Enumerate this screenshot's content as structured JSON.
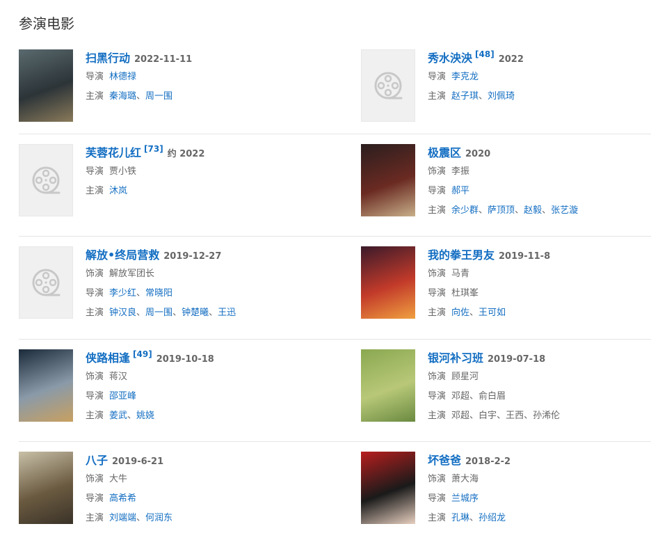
{
  "section": {
    "title": "参演电影"
  },
  "colors": {
    "link": "#136ec2",
    "muted": "#666666",
    "divider": "#e5e5e5"
  },
  "movies": [
    {
      "title": "扫黑行动",
      "ref": "",
      "year": "2022-11-11",
      "poster": {
        "kind": "image",
        "tones": [
          "#5a6a6e",
          "#2c3438",
          "#8a7a5a"
        ]
      },
      "credits": [
        {
          "label": "导演",
          "names": [
            "林德禄"
          ],
          "linked": true
        },
        {
          "label": "主演",
          "names": [
            "秦海璐",
            "周一围"
          ],
          "linked": true
        }
      ]
    },
    {
      "title": "秀水泱泱",
      "ref": "[48]",
      "year": "2022",
      "poster": {
        "kind": "placeholder"
      },
      "credits": [
        {
          "label": "导演",
          "names": [
            "李克龙"
          ],
          "linked": true
        },
        {
          "label": "主演",
          "names": [
            "赵子琪",
            "刘佩琦"
          ],
          "linked": true
        }
      ]
    },
    {
      "title": "芙蓉花儿红",
      "ref": "[73]",
      "year": "约 2022",
      "poster": {
        "kind": "placeholder"
      },
      "credits": [
        {
          "label": "导演",
          "names": [
            "贾小铁"
          ],
          "linked": false
        },
        {
          "label": "主演",
          "names": [
            "沐岚"
          ],
          "linked": true
        }
      ]
    },
    {
      "title": "极震区",
      "ref": "",
      "year": "2020",
      "poster": {
        "kind": "image",
        "tones": [
          "#2a1e1e",
          "#6a2a22",
          "#c8b08a"
        ]
      },
      "credits": [
        {
          "label": "饰演",
          "names": [
            "李振"
          ],
          "linked": false
        },
        {
          "label": "导演",
          "names": [
            "郝平"
          ],
          "linked": true
        },
        {
          "label": "主演",
          "names": [
            "余少群",
            "萨顶顶",
            "赵毅",
            "张艺漩"
          ],
          "linked": true
        }
      ]
    },
    {
      "title": "解放•终局营救",
      "ref": "",
      "year": "2019-12-27",
      "poster": {
        "kind": "placeholder"
      },
      "credits": [
        {
          "label": "饰演",
          "names": [
            "解放军团长"
          ],
          "linked": false
        },
        {
          "label": "导演",
          "names": [
            "李少红",
            "常晓阳"
          ],
          "linked": true
        },
        {
          "label": "主演",
          "names": [
            "钟汉良",
            "周一围",
            "钟楚曦",
            "王迅"
          ],
          "linked": true
        }
      ]
    },
    {
      "title": "我的拳王男友",
      "ref": "",
      "year": "2019-11-8",
      "poster": {
        "kind": "image",
        "tones": [
          "#3a1a2a",
          "#c23a2a",
          "#f0a040"
        ]
      },
      "credits": [
        {
          "label": "饰演",
          "names": [
            "马青"
          ],
          "linked": false
        },
        {
          "label": "导演",
          "names": [
            "杜琪峯"
          ],
          "linked": false
        },
        {
          "label": "主演",
          "names": [
            "向佐",
            "王可如"
          ],
          "linked": true
        }
      ]
    },
    {
      "title": "侠路相逢",
      "ref": "[49]",
      "year": "2019-10-18",
      "poster": {
        "kind": "image",
        "tones": [
          "#1a2a3a",
          "#8a9aa8",
          "#c8a060"
        ]
      },
      "credits": [
        {
          "label": "饰演",
          "names": [
            "蒋汉"
          ],
          "linked": false
        },
        {
          "label": "导演",
          "names": [
            "邵亚峰"
          ],
          "linked": true
        },
        {
          "label": "主演",
          "names": [
            "姜武",
            "姚娆"
          ],
          "linked": true
        }
      ]
    },
    {
      "title": "银河补习班",
      "ref": "",
      "year": "2019-07-18",
      "poster": {
        "kind": "image",
        "tones": [
          "#8aa850",
          "#b8c878",
          "#6a8a40"
        ]
      },
      "credits": [
        {
          "label": "饰演",
          "names": [
            "顾星河"
          ],
          "linked": false
        },
        {
          "label": "导演",
          "names": [
            "邓超",
            "俞白眉"
          ],
          "linked": false
        },
        {
          "label": "主演",
          "names": [
            "邓超",
            "白宇",
            "王西",
            "孙浠伦"
          ],
          "linked": false
        }
      ]
    },
    {
      "title": "八子",
      "ref": "",
      "year": "2019-6-21",
      "poster": {
        "kind": "image",
        "tones": [
          "#c8c0a8",
          "#6a5a40",
          "#3a3228"
        ]
      },
      "credits": [
        {
          "label": "饰演",
          "names": [
            "大牛"
          ],
          "linked": false
        },
        {
          "label": "导演",
          "names": [
            "高希希"
          ],
          "linked": true
        },
        {
          "label": "主演",
          "names": [
            "刘端端",
            "何润东"
          ],
          "linked": true
        }
      ]
    },
    {
      "title": "坏爸爸",
      "ref": "",
      "year": "2018-2-2",
      "poster": {
        "kind": "image",
        "tones": [
          "#b81e1e",
          "#1a1a1a",
          "#e8d0c0"
        ]
      },
      "credits": [
        {
          "label": "饰演",
          "names": [
            "萧大海"
          ],
          "linked": false
        },
        {
          "label": "导演",
          "names": [
            "兰城序"
          ],
          "linked": true
        },
        {
          "label": "主演",
          "names": [
            "孔琳",
            "孙绍龙"
          ],
          "linked": true
        }
      ]
    }
  ]
}
